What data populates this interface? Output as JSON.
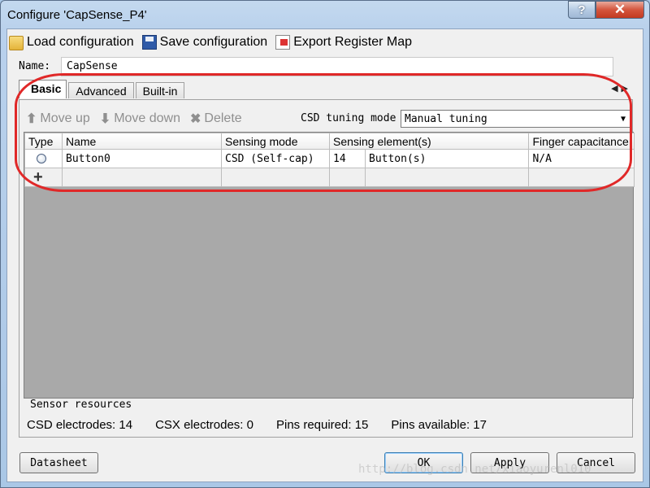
{
  "window": {
    "title": "Configure 'CapSense_P4'"
  },
  "titlebar": {
    "help_label": "?",
    "close_label": "✕"
  },
  "toolbar": {
    "load_label": "Load configuration",
    "save_label": "Save configuration",
    "export_label": "Export Register Map"
  },
  "name": {
    "label": "Name:",
    "value": "CapSense"
  },
  "tabs": [
    {
      "label": "Basic",
      "active": true
    },
    {
      "label": "Advanced",
      "active": false
    },
    {
      "label": "Built-in",
      "active": false
    }
  ],
  "tab_nav": {
    "left": "◀",
    "right": "▶"
  },
  "panel_toolbar": {
    "move_up": "Move up",
    "move_down": "Move down",
    "delete": "Delete",
    "csd_tuning_label": "CSD tuning mode",
    "csd_tuning_value": "Manual tuning"
  },
  "grid": {
    "columns": [
      "Type",
      "Name",
      "Sensing mode",
      "Sensing element(s)",
      "Finger capacitance"
    ],
    "rows": [
      {
        "type": "radio",
        "name": "Button0",
        "sensing_mode": "CSD (Self-cap)",
        "element_count": "14",
        "element_type": "Button(s)",
        "finger_cap": "N/A"
      }
    ],
    "add_label": "+"
  },
  "sensor_resources": {
    "title": "Sensor resources",
    "csd_electrodes": "CSD electrodes:  14",
    "csx_electrodes": "CSX electrodes:  0",
    "pins_required": "Pins required:  15",
    "pins_available": "Pins available:  17"
  },
  "buttons": {
    "datasheet": "Datasheet",
    "ok": "OK",
    "apply": "Apply",
    "cancel": "Cancel"
  },
  "watermark": "http://blog.csdn.net/xiaoyurenl010",
  "colors": {
    "annotation": "#e02828",
    "titlebar": "#b9d1ec",
    "close_button": "#c33a21"
  }
}
